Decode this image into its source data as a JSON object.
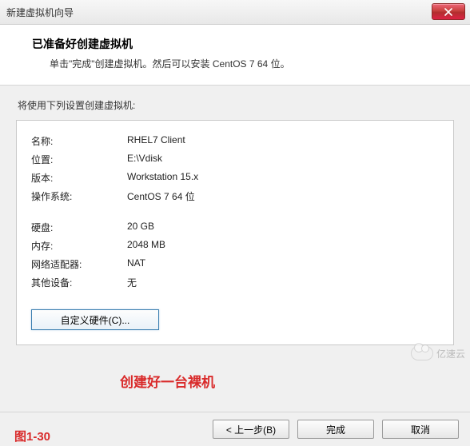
{
  "window": {
    "title": "新建虚拟机向导"
  },
  "header": {
    "heading": "已准备好创建虚拟机",
    "subtext": "单击\"完成\"创建虚拟机。然后可以安装 CentOS 7 64 位。"
  },
  "body": {
    "intro": "将使用下列设置创建虚拟机:",
    "rows": [
      {
        "k": "名称:",
        "v": "RHEL7 Client"
      },
      {
        "k": "位置:",
        "v": "E:\\Vdisk"
      },
      {
        "k": "版本:",
        "v": "Workstation 15.x"
      },
      {
        "k": "操作系统:",
        "v": "CentOS 7 64 位"
      }
    ],
    "rows2": [
      {
        "k": "硬盘:",
        "v": "20 GB"
      },
      {
        "k": "内存:",
        "v": "2048 MB"
      },
      {
        "k": "网络适配器:",
        "v": "NAT"
      },
      {
        "k": "其他设备:",
        "v": "无"
      }
    ],
    "customize_label": "自定义硬件(C)..."
  },
  "footer": {
    "back": "< 上一步(B)",
    "finish": "完成",
    "cancel": "取消"
  },
  "annotation": "创建好一台裸机",
  "figure_label": "图1-30",
  "watermark": "亿速云"
}
